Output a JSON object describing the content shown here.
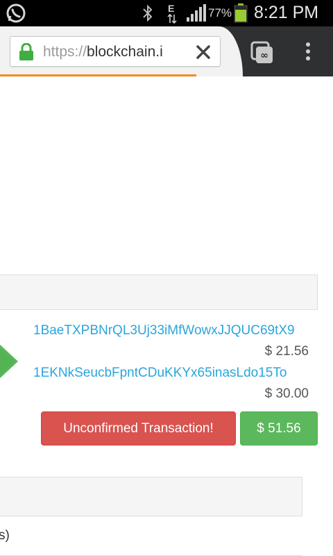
{
  "status_bar": {
    "battery_percent": "77%",
    "time": "8:21 PM",
    "network_type": "E"
  },
  "browser": {
    "url_scheme": "https://",
    "url_host": "blockchain.i",
    "progress_fraction": 0.59,
    "progress_color": "#f48a1f"
  },
  "transaction": {
    "outputs": [
      {
        "address": "1BaeTXPBNrQL3Uj33iMfWowxJJQUC69tX9",
        "amount": "$ 21.56"
      },
      {
        "address": "1EKNkSeucbFpntCDuKKYx65inasLdo15To",
        "amount": "$ 30.00"
      }
    ],
    "status_label": "Unconfirmed Transaction!",
    "total_label": "$ 51.56",
    "status_color": "#d9534f",
    "total_color": "#5cb85c",
    "address_color": "#2aa5dc"
  },
  "second_table": {
    "row_text": "s)"
  },
  "icons": {
    "status_left": "whatsapp-icon",
    "bluetooth": "bluetooth-icon",
    "signal": "signal-icon",
    "battery": "battery-icon",
    "lock": "lock-icon",
    "clear": "close-icon",
    "tabs": "tab-switcher-icon",
    "menu": "overflow-menu-icon",
    "arrow": "arrow-right-icon"
  }
}
